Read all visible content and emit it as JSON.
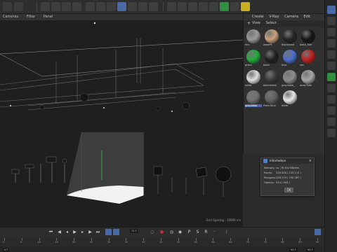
{
  "viewport": {
    "menu": [
      "Cameras",
      "Filter",
      "Panel"
    ],
    "grid_spacing": "Grid Spacing : 10000 cm"
  },
  "materials": {
    "menu": [
      "Create",
      "V-Ray",
      "Camera",
      "Edit",
      "View",
      "Select"
    ],
    "items": [
      {
        "label": "env",
        "color": "#9a9a9a"
      },
      {
        "label": "wood*F",
        "color": "#c9a07a"
      },
      {
        "label": "blackwood",
        "color": "#262626"
      },
      {
        "label": "black_Mirr",
        "color": "#151515"
      },
      {
        "label": "green",
        "color": "#1fae3a"
      },
      {
        "label": "black",
        "color": "#202020"
      },
      {
        "label": "blue",
        "color": "#4a6fd0"
      },
      {
        "label": "red",
        "color": "#c02020"
      },
      {
        "label": "white",
        "color": "#e0e0e0"
      },
      {
        "label": "blackmetal",
        "color": "#3a3a3a"
      },
      {
        "label": "greymetal_",
        "color": "#8c8c8c"
      },
      {
        "label": "downTube",
        "color": "#a8a8a8"
      },
      {
        "label": "greymetal",
        "color": "#707070"
      },
      {
        "label": "Proto Stud",
        "color": "#606060"
      },
      {
        "label": "white",
        "color": "#e8e8e8"
      }
    ]
  },
  "info_window": {
    "title": "Information",
    "rows": [
      {
        "label": "Memory:",
        "value": "ca. 76 452 KBytes"
      },
      {
        "label": "Points:",
        "value": "228 528 ( 233 112 )"
      },
      {
        "label": "Polygons:",
        "value": "228 219 ( 230 287 )"
      },
      {
        "label": "Objects:",
        "value": "914 ( 993 )"
      }
    ],
    "ok_label": "OK"
  },
  "timeline": {
    "current_frame": "72 F",
    "ruler_labels": [
      "0",
      "5",
      "10",
      "15",
      "20",
      "25",
      "30",
      "35",
      "40",
      "45",
      "50",
      "55",
      "60",
      "65",
      "70",
      "75",
      "80",
      "85",
      "90"
    ],
    "start_field": "0 F",
    "end_field": "90 F",
    "end_field2": "90 F"
  },
  "colors": {
    "accent": "#4a6aa7",
    "record": "#d03030",
    "light_green": "#3ccf5a"
  }
}
